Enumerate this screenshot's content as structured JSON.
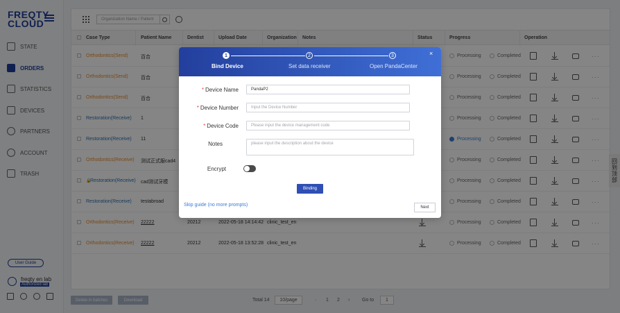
{
  "app": {
    "logo_line1": "FREQTY",
    "logo_line2": "CLOUD"
  },
  "sidebar": {
    "items": [
      {
        "label": "STATE",
        "icon": "state-icon"
      },
      {
        "label": "ORDERS",
        "icon": "orders-icon",
        "active": true
      },
      {
        "label": "STATISTICS",
        "icon": "statistics-icon"
      },
      {
        "label": "DEVICES",
        "icon": "devices-icon"
      },
      {
        "label": "PARTNERS",
        "icon": "partners-icon"
      },
      {
        "label": "ACCOUNT",
        "icon": "account-icon"
      },
      {
        "label": "TRASH",
        "icon": "trash-icon"
      }
    ],
    "user_guide": "User Guide",
    "user_name": "freqty en lab",
    "user_badge": "Authorized lab"
  },
  "toolbar": {
    "search_placeholder": "Organization Name / Patient"
  },
  "table": {
    "headers": [
      "Case Type",
      "Patient Name",
      "Dentist",
      "Upload Date",
      "Organization",
      "Notes",
      "Status",
      "Progress",
      "Operation"
    ],
    "rows": [
      {
        "case_type": "Orthodontics(Send)",
        "patient": "百合",
        "dentist": "",
        "date": "",
        "org": "",
        "kind": "ortho",
        "processing": false
      },
      {
        "case_type": "Orthodontics(Send)",
        "patient": "百合",
        "dentist": "",
        "date": "",
        "org": "",
        "kind": "ortho",
        "processing": false
      },
      {
        "case_type": "Orthodontics(Send)",
        "patient": "百合",
        "dentist": "",
        "date": "",
        "org": "",
        "kind": "ortho",
        "processing": false
      },
      {
        "case_type": "Restoration(Receive)",
        "patient": "1",
        "dentist": "",
        "date": "",
        "org": "",
        "kind": "rest",
        "processing": false
      },
      {
        "case_type": "Restoration(Receive)",
        "patient": "11",
        "dentist": "",
        "date": "",
        "org": "",
        "kind": "rest",
        "processing": true
      },
      {
        "case_type": "Orthodontics(Receive)",
        "patient": "测试正式服cad4",
        "dentist": "",
        "date": "",
        "org": "",
        "kind": "ortho",
        "processing": false
      },
      {
        "case_type": "Restoration(Receive)",
        "patient": "cad测试牙模",
        "dentist": "",
        "date": "",
        "org": "",
        "kind": "rest",
        "processing": false,
        "locked": true
      },
      {
        "case_type": "Restoration(Receive)",
        "patient": "testabroad",
        "dentist": "",
        "date": "",
        "org": "",
        "kind": "rest",
        "processing": false
      },
      {
        "case_type": "Orthodontics(Receive)",
        "patient": "22222",
        "dentist": "20212",
        "date": "2022-05-18 14:14:42",
        "org": "clinic_test_en",
        "kind": "ortho",
        "processing": false
      },
      {
        "case_type": "Orthodontics(Receive)",
        "patient": "22222",
        "dentist": "20212",
        "date": "2022-05-18 13:52:28",
        "org": "clinic_test_en",
        "kind": "ortho",
        "processing": false
      }
    ],
    "progress_processing": "Processing",
    "progress_completed": "Completed"
  },
  "footer": {
    "delete_label": "Delete in batches",
    "download_label": "Download",
    "total": "Total 14",
    "page_size": "10/page",
    "page1": "1",
    "page2": "2",
    "goto_label": "Go to",
    "goto_value": "1"
  },
  "side_tab": "回到顶部",
  "modal": {
    "steps": [
      {
        "num": "1",
        "label": "Bind Device",
        "active": true
      },
      {
        "num": "2",
        "label": "Set data receiver",
        "active": false
      },
      {
        "num": "3",
        "label": "Open PandaCenter",
        "active": false
      }
    ],
    "close": "×",
    "fields": {
      "device_name_label": "Device Name",
      "device_name_value": "PandaP2",
      "device_number_label": "Device Number",
      "device_number_placeholder": "Input the Device Number",
      "device_code_label": "Device Code",
      "device_code_placeholder": "Please input the device management code",
      "notes_label": "Notes",
      "notes_placeholder": "please input the description about the device",
      "encrypt_label": "Encrypt",
      "required_mark": "*"
    },
    "bind_button": "Binding",
    "skip_link": "Skip guide (no more prompts)",
    "next_button": "Next"
  }
}
